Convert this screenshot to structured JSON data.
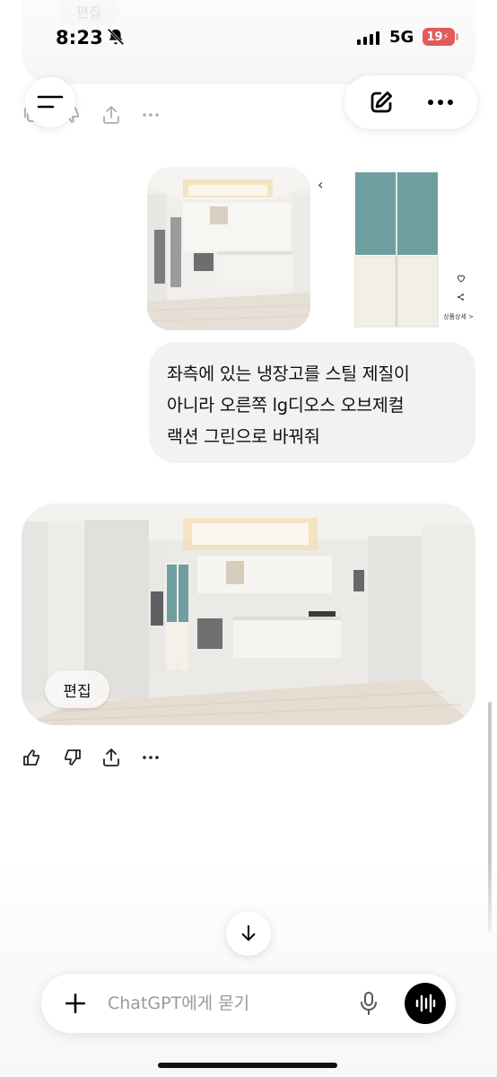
{
  "status_bar": {
    "time": "8:23",
    "network": "5G",
    "battery": "19"
  },
  "header": {
    "menu_icon": "hamburger-menu-icon",
    "new_chat_icon": "compose-icon",
    "more_icon": "more-horizontal-icon"
  },
  "previous_message": {
    "edit_label": "편집"
  },
  "user_message": {
    "attachments": [
      {
        "kind": "image",
        "description_icon": "kitchen-photo"
      },
      {
        "kind": "image",
        "description_icon": "refrigerator-product-photo"
      }
    ],
    "fridge_detail_label": "상품상세 >",
    "lines": [
      "좌측에 있는 냉장고를 스틸 제질이",
      "아니라 오른쪽 lg디오스 오브제컬",
      "랙션 그린으로 바꿔줘"
    ]
  },
  "assistant_message": {
    "image_edit_label": "편집",
    "actions": [
      "thumbs-up-icon",
      "thumbs-down-icon",
      "share-icon",
      "more-horizontal-icon"
    ]
  },
  "composer": {
    "placeholder": "ChatGPT에게 묻기"
  },
  "colors": {
    "accent": "#000000",
    "battery": "#e25b5b",
    "bubble": "#f2f2f2",
    "fridge_green": "#6f9ea0",
    "fridge_cream": "#f1efe6"
  }
}
